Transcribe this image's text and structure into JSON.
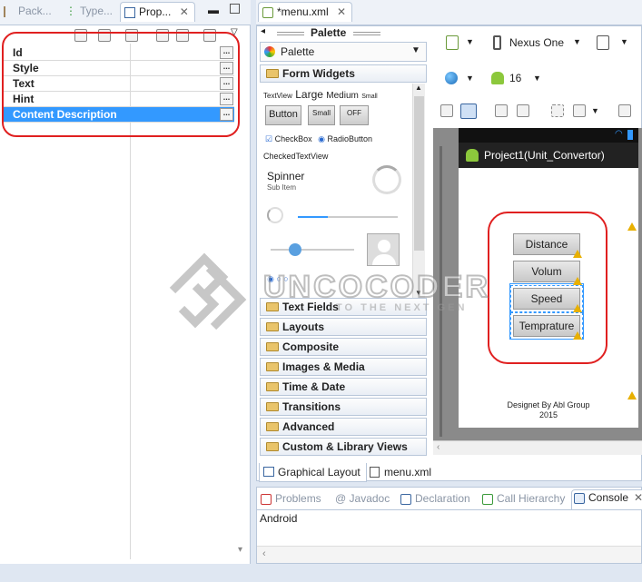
{
  "left_tabs": [
    {
      "label": "Pack..."
    },
    {
      "label": "Type..."
    },
    {
      "label": "Prop..."
    }
  ],
  "properties": [
    {
      "label": "Id"
    },
    {
      "label": "Style"
    },
    {
      "label": "Text"
    },
    {
      "label": "Hint"
    },
    {
      "label": "Content Description"
    }
  ],
  "ellipsis": "...",
  "editor_tab": {
    "label": "*menu.xml"
  },
  "palette": {
    "header": "Palette",
    "dropdown_label": "Palette",
    "categories_open": "Form Widgets",
    "textview_row": {
      "tv": "TextView",
      "large": "Large",
      "medium": "Medium",
      "small": "Small"
    },
    "buttons": {
      "button": "Button",
      "small": "Small",
      "off": "OFF"
    },
    "checkbox": "CheckBox",
    "radio": "RadioButton",
    "checked_text": "CheckedTextView",
    "spinner": "Spinner",
    "sub_item": "Sub Item",
    "categories": [
      "Text Fields",
      "Layouts",
      "Composite",
      "Images & Media",
      "Time & Date",
      "Transitions",
      "Advanced",
      "Custom & Library Views"
    ]
  },
  "device": {
    "name": "Nexus One",
    "api": "16"
  },
  "app_title": "Project1(Unit_Convertor)",
  "app_buttons": [
    "Distance",
    "Volum",
    "Speed",
    "Temprature"
  ],
  "footer_text": "Designet  By Abl Group 2015",
  "bottom_tabs": [
    "Graphical Layout",
    "menu.xml"
  ],
  "console_tabs": [
    "Problems",
    "@ Javadoc",
    "Declaration",
    "Call Hierarchy",
    "Console"
  ],
  "console_text": "Android",
  "watermark": {
    "main": "UNCOCODER",
    "tag": "TO THE NEXT GEN"
  }
}
